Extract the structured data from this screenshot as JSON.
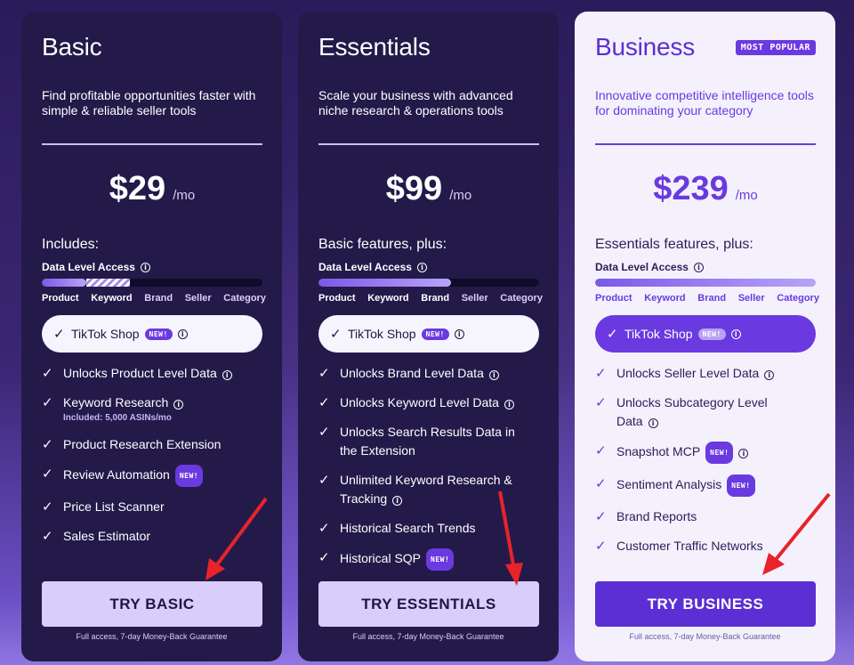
{
  "plans": [
    {
      "name": "Basic",
      "badge": "",
      "description": "Find profitable opportunities faster with simple & reliable seller tools",
      "price": "$29",
      "period": "/mo",
      "includes": "Includes:",
      "data_level_label": "Data Level Access",
      "data_level_fraction": 0.4,
      "levels": [
        "Product",
        "Keyword",
        "Brand",
        "Seller",
        "Category"
      ],
      "pill": {
        "label": "TikTok Shop",
        "badge": "NEW!"
      },
      "features": [
        {
          "text": "Unlocks Product Level Data",
          "info": true
        },
        {
          "text": "Keyword Research",
          "info": true,
          "sub": "Included: 5,000 ASINs/mo"
        },
        {
          "text": "Product Research Extension"
        },
        {
          "text": "Review Automation",
          "badge": "NEW!"
        },
        {
          "text": "Price List Scanner"
        },
        {
          "text": "Sales Estimator"
        }
      ],
      "cta": "TRY BASIC",
      "guarantee": "Full access, 7-day Money-Back Guarantee"
    },
    {
      "name": "Essentials",
      "badge": "",
      "description": "Scale your business with advanced niche research & operations tools",
      "price": "$99",
      "period": "/mo",
      "includes": "Basic features, plus:",
      "data_level_label": "Data Level Access",
      "data_level_fraction": 0.6,
      "levels": [
        "Product",
        "Keyword",
        "Brand",
        "Seller",
        "Category"
      ],
      "pill": {
        "label": "TikTok Shop",
        "badge": "NEW!"
      },
      "features": [
        {
          "text": "Unlocks Brand Level Data",
          "info": true
        },
        {
          "text": "Unlocks Keyword Level Data",
          "info": true
        },
        {
          "text": "Unlocks Search Results Data in the Extension"
        },
        {
          "text": "Unlimited Keyword Research & Tracking",
          "info": true
        },
        {
          "text": "Historical Search Trends"
        },
        {
          "text": "Historical SQP",
          "badge": "NEW!"
        }
      ],
      "cta": "TRY ESSENTIALS",
      "guarantee": "Full access, 7-day Money-Back Guarantee"
    },
    {
      "name": "Business",
      "badge": "MOST POPULAR",
      "description": "Innovative competitive intelligence tools for dominating your category",
      "price": "$239",
      "period": "/mo",
      "includes": "Essentials features, plus:",
      "data_level_label": "Data Level Access",
      "data_level_fraction": 1.0,
      "levels": [
        "Product",
        "Keyword",
        "Brand",
        "Seller",
        "Category"
      ],
      "pill": {
        "label": "TikTok Shop",
        "badge": "NEW!"
      },
      "features": [
        {
          "text": "Unlocks Seller Level Data",
          "info": true
        },
        {
          "text": "Unlocks Subcategory Level Data",
          "info": true
        },
        {
          "text": "Snapshot MCP",
          "badge": "NEW!",
          "info": true
        },
        {
          "text": "Sentiment Analysis",
          "badge": "NEW!"
        },
        {
          "text": "Brand Reports"
        },
        {
          "text": "Customer Traffic Networks"
        }
      ],
      "cta": "TRY BUSINESS",
      "guarantee": "Full access, 7-day Money-Back Guarantee"
    }
  ],
  "colors": {
    "accent": "#6a3ae0",
    "dark_card": "#231a4a",
    "arrow": "#e8232a"
  },
  "icons": {
    "check": "check-icon",
    "info": "info-icon",
    "arrow": "red-arrow-annotation"
  }
}
